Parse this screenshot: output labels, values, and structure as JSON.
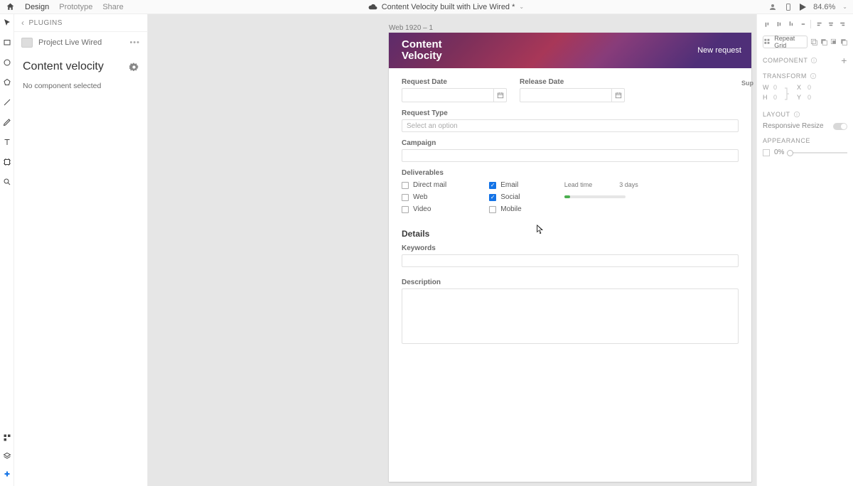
{
  "topbar": {
    "tabs": [
      "Design",
      "Prototype",
      "Share"
    ],
    "active_tab": "Design",
    "doc_name": "Content Velocity built with Live Wired *",
    "zoom": "84.6%"
  },
  "left_panel": {
    "plugins_label": "PLUGINS",
    "asset_name": "Project Live Wired",
    "panel_title": "Content velocity",
    "no_selection": "No component selected"
  },
  "canvas": {
    "artboard_label": "Web 1920 – 1",
    "app_title_line1": "Content",
    "app_title_line2": "Velocity",
    "new_request": "New request",
    "request_date_label": "Request Date",
    "release_date_label": "Release Date",
    "request_type_label": "Request Type",
    "request_type_placeholder": "Select an option",
    "campaign_label": "Campaign",
    "deliverables_label": "Deliverables",
    "deliverables": [
      {
        "name": "Direct mail",
        "checked": false
      },
      {
        "name": "Web",
        "checked": false
      },
      {
        "name": "Video",
        "checked": false
      },
      {
        "name": "Email",
        "checked": true
      },
      {
        "name": "Social",
        "checked": true
      },
      {
        "name": "Mobile",
        "checked": false
      }
    ],
    "lead_time_label": "Lead time",
    "lead_time_value": "3 days",
    "details_heading": "Details",
    "keywords_label": "Keywords",
    "description_label": "Description",
    "artboard2_sup": "Sup"
  },
  "right_panel": {
    "repeat_grid": "Repeat Grid",
    "component_label": "COMPONENT",
    "transform_label": "TRANSFORM",
    "w_label": "W",
    "w_val": "0",
    "h_label": "H",
    "h_val": "0",
    "x_label": "X",
    "x_val": "0",
    "y_label": "Y",
    "y_val": "0",
    "layout_label": "LAYOUT",
    "responsive_label": "Responsive Resize",
    "appearance_label": "APPEARANCE",
    "opacity": "0%"
  }
}
